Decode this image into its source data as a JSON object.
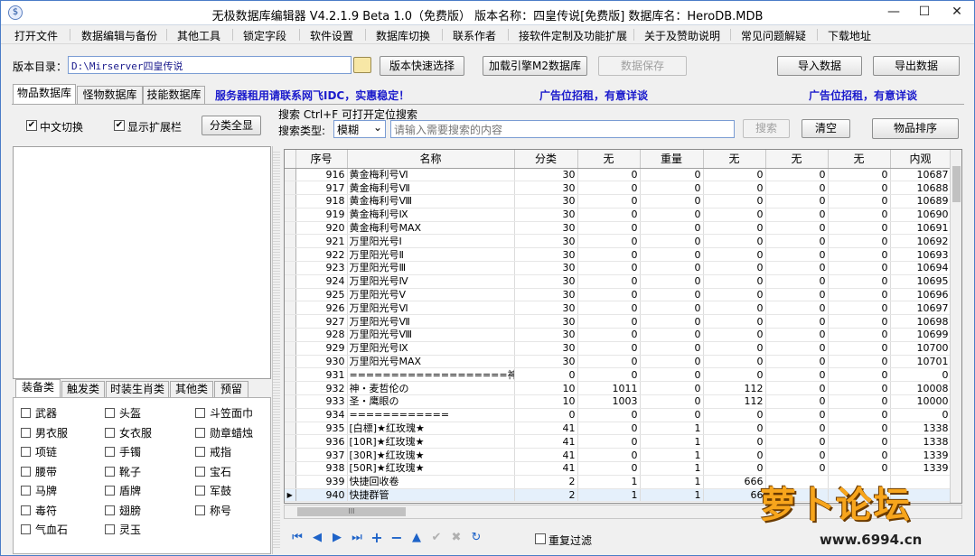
{
  "window": {
    "title": "无极数据库编辑器 V4.2.1.9   Beta 1.0（免费版）    版本名称：四皇传说[免费版]     数据库名：HeroDB.MDB",
    "minimize": "—",
    "maximize": "☐",
    "close": "✕"
  },
  "menu": [
    "打开文件",
    "数据编辑与备份",
    "其他工具",
    "锁定字段",
    "软件设置",
    "数据库切换",
    "联系作者",
    "接软件定制及功能扩展",
    "关于及赞助说明",
    "常见问题解疑",
    "下载地址"
  ],
  "toolbar": {
    "dir_label": "版本目录：",
    "dir_value": "D:\\Mirserver四皇传说",
    "quick_select": "版本快速选择",
    "load_engine": "加载引擎M2数据库",
    "save_data": "数据保存",
    "import": "导入数据",
    "export": "导出数据"
  },
  "tabs": [
    "物品数据库",
    "怪物数据库",
    "技能数据库"
  ],
  "ads": {
    "server": "服务器租用请联系网飞IDC，实惠稳定！",
    "ad1": "广告位招租，有意详谈",
    "ad2": "广告位招租，有意详谈"
  },
  "options": {
    "chinese_switch": "中文切换",
    "show_ext": "显示扩展栏",
    "show_all": "分类全显"
  },
  "search": {
    "title": "搜索   Ctrl+F 可打开定位搜索",
    "type_label": "搜索类型:",
    "type_value": "模糊",
    "placeholder": "请输入需要搜索的内容",
    "search_btn": "搜索",
    "clear_btn": "清空",
    "sort_btn": "物品排序"
  },
  "grid": {
    "columns": [
      "序号",
      "名称",
      "分类",
      "无",
      "重量",
      "无",
      "无",
      "无",
      "内观"
    ],
    "rows": [
      [
        "916",
        "黄金梅利号Ⅵ",
        "30",
        "0",
        "0",
        "0",
        "0",
        "0",
        "10687"
      ],
      [
        "917",
        "黄金梅利号Ⅶ",
        "30",
        "0",
        "0",
        "0",
        "0",
        "0",
        "10688"
      ],
      [
        "918",
        "黄金梅利号Ⅷ",
        "30",
        "0",
        "0",
        "0",
        "0",
        "0",
        "10689"
      ],
      [
        "919",
        "黄金梅利号Ⅸ",
        "30",
        "0",
        "0",
        "0",
        "0",
        "0",
        "10690"
      ],
      [
        "920",
        "黄金梅利号MAX",
        "30",
        "0",
        "0",
        "0",
        "0",
        "0",
        "10691"
      ],
      [
        "921",
        "万里阳光号Ⅰ",
        "30",
        "0",
        "0",
        "0",
        "0",
        "0",
        "10692"
      ],
      [
        "922",
        "万里阳光号Ⅱ",
        "30",
        "0",
        "0",
        "0",
        "0",
        "0",
        "10693"
      ],
      [
        "923",
        "万里阳光号Ⅲ",
        "30",
        "0",
        "0",
        "0",
        "0",
        "0",
        "10694"
      ],
      [
        "924",
        "万里阳光号Ⅳ",
        "30",
        "0",
        "0",
        "0",
        "0",
        "0",
        "10695"
      ],
      [
        "925",
        "万里阳光号Ⅴ",
        "30",
        "0",
        "0",
        "0",
        "0",
        "0",
        "10696"
      ],
      [
        "926",
        "万里阳光号Ⅵ",
        "30",
        "0",
        "0",
        "0",
        "0",
        "0",
        "10697"
      ],
      [
        "927",
        "万里阳光号Ⅶ",
        "30",
        "0",
        "0",
        "0",
        "0",
        "0",
        "10698"
      ],
      [
        "928",
        "万里阳光号Ⅷ",
        "30",
        "0",
        "0",
        "0",
        "0",
        "0",
        "10699"
      ],
      [
        "929",
        "万里阳光号Ⅸ",
        "30",
        "0",
        "0",
        "0",
        "0",
        "0",
        "10700"
      ],
      [
        "930",
        "万里阳光号MAX",
        "30",
        "0",
        "0",
        "0",
        "0",
        "0",
        "10701"
      ],
      [
        "931",
        "===================神级皮肤",
        "0",
        "0",
        "0",
        "0",
        "0",
        "0",
        "0"
      ],
      [
        "932",
        "神・麦哲伦の",
        "10",
        "1011",
        "0",
        "112",
        "0",
        "0",
        "10008"
      ],
      [
        "933",
        "圣・鹰眼の",
        "10",
        "1003",
        "0",
        "112",
        "0",
        "0",
        "10000"
      ],
      [
        "934",
        "============",
        "0",
        "0",
        "0",
        "0",
        "0",
        "0",
        "0"
      ],
      [
        "935",
        "[白標]★红玫瑰★",
        "41",
        "0",
        "1",
        "0",
        "0",
        "0",
        "1338"
      ],
      [
        "936",
        "[10R]★红玫瑰★",
        "41",
        "0",
        "1",
        "0",
        "0",
        "0",
        "1338"
      ],
      [
        "937",
        "[30R]★红玫瑰★",
        "41",
        "0",
        "1",
        "0",
        "0",
        "0",
        "1339"
      ],
      [
        "938",
        "[50R]★红玫瑰★",
        "41",
        "0",
        "1",
        "0",
        "0",
        "0",
        "1339"
      ],
      [
        "939",
        "快捷回收卷",
        "2",
        "1",
        "1",
        "666",
        "",
        "",
        ""
      ],
      [
        "940",
        "快捷群管",
        "2",
        "1",
        "1",
        "66",
        "",
        "",
        ""
      ]
    ],
    "selected_row_marker": "▶"
  },
  "category_tabs": [
    "装备类",
    "触发类",
    "时装生肖类",
    "其他类",
    "预留"
  ],
  "categories": [
    "武器",
    "头盔",
    "斗笠面巾",
    "男衣服",
    "女衣服",
    "勋章蜡烛",
    "项链",
    "手镯",
    "戒指",
    "腰带",
    "靴子",
    "宝石",
    "马牌",
    "盾牌",
    "军鼓",
    "毒符",
    "翅膀",
    "称号",
    "气血石",
    "灵玉"
  ],
  "nav": {
    "first": "⏮",
    "prev": "◀",
    "next": "▶",
    "last": "⏭",
    "add": "+",
    "remove": "−",
    "up": "▲",
    "confirm": "✔",
    "cancel": "✖",
    "refresh": "↻",
    "dup_filter": "重复过滤",
    "hscroll_grip": "III"
  },
  "watermark": {
    "text": "萝卜论坛",
    "url": "www.6994.cn"
  },
  "colors": {
    "accent_blue": "#1b1bcc",
    "nav_blue": "#1e63c8",
    "selection": "#e5f0fb"
  }
}
